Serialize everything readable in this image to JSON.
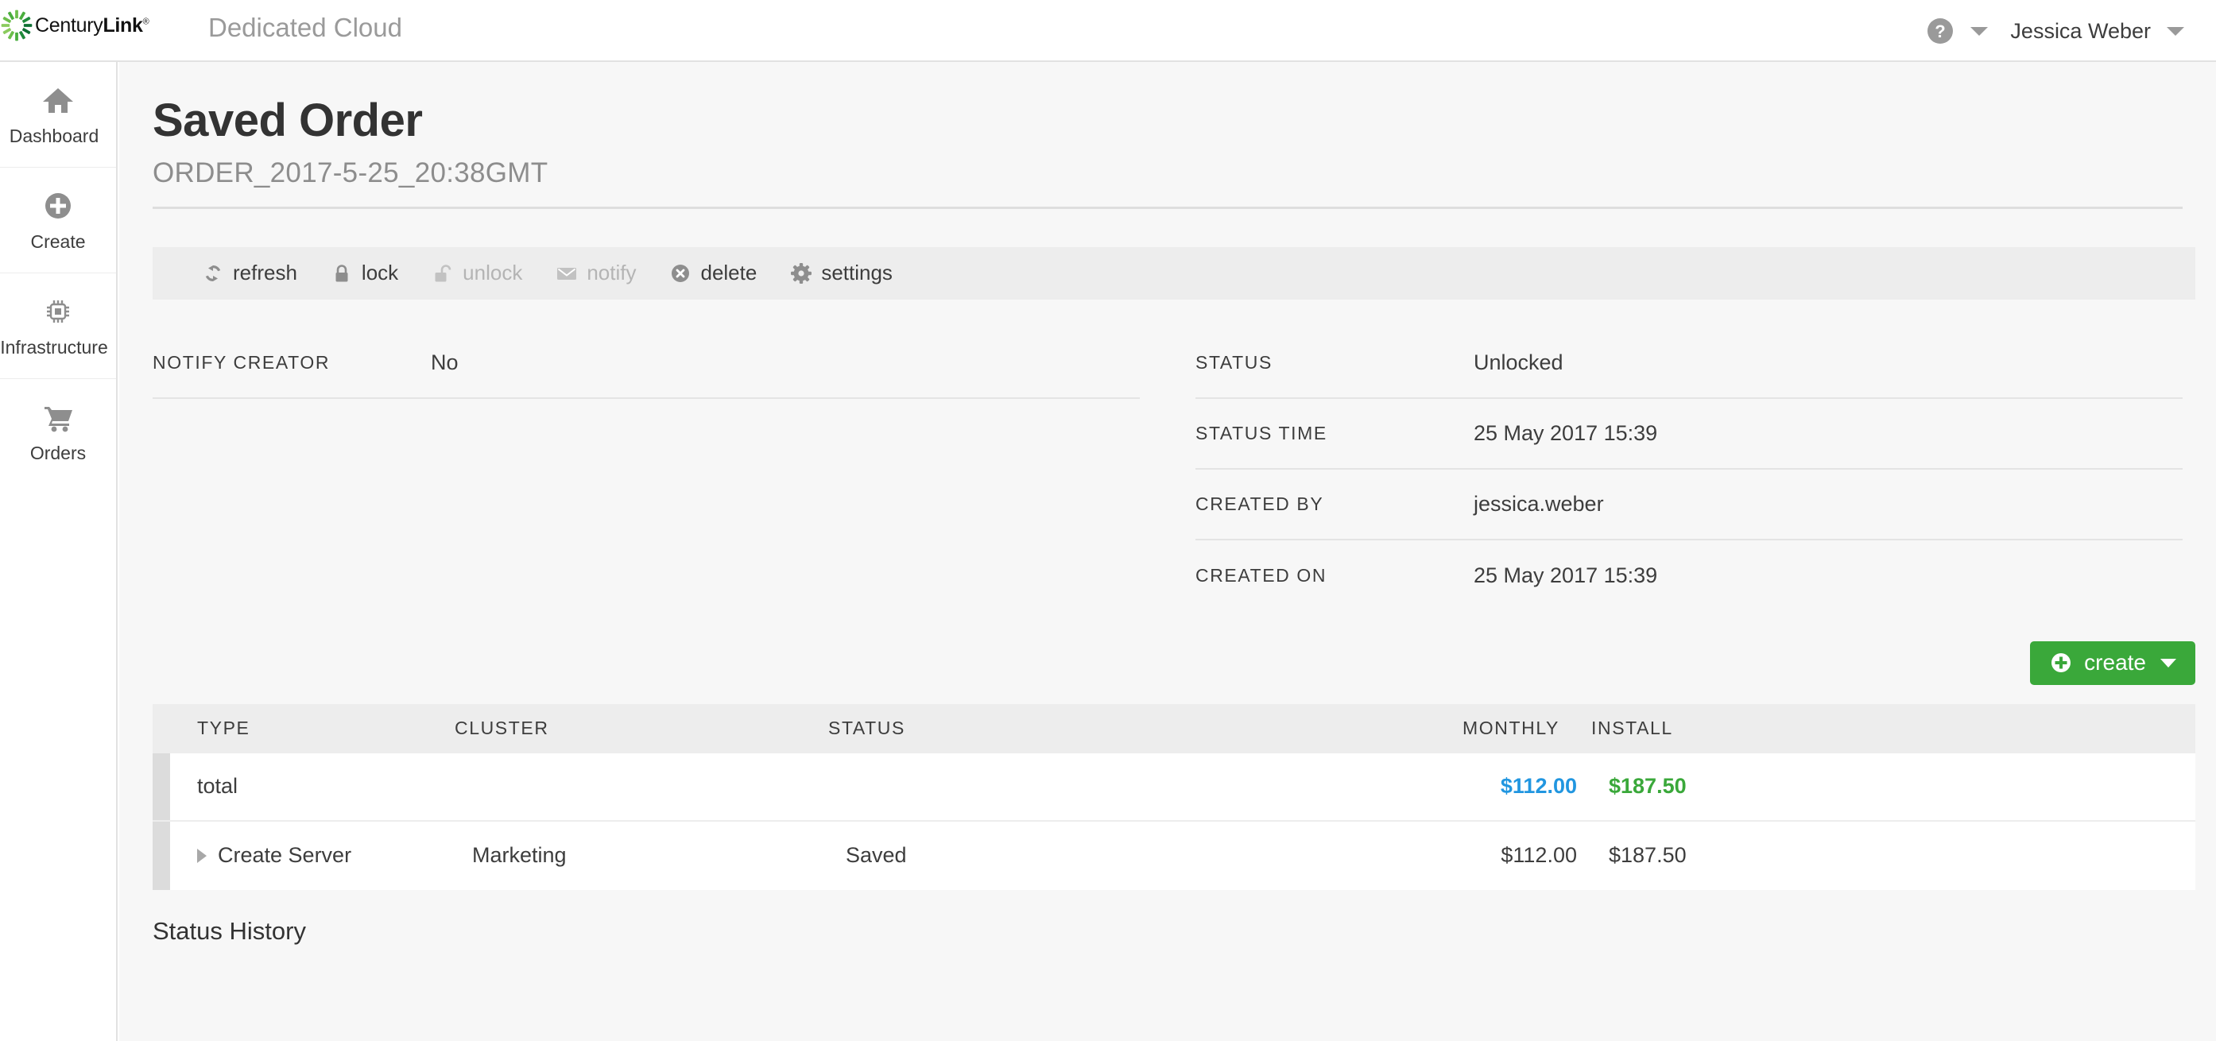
{
  "topbar": {
    "brand_name": "CenturyLink",
    "brand_registered": "®",
    "app_title": "Dedicated Cloud",
    "help_icon": "help-circle-icon",
    "help_caret_icon": "chevron-down-icon",
    "user_name": "Jessica Weber",
    "user_caret_icon": "chevron-down-icon"
  },
  "sidebar": {
    "items": [
      {
        "label": "Dashboard",
        "icon": "home-icon"
      },
      {
        "label": "Create",
        "icon": "plus-circle-icon"
      },
      {
        "label": "Infrastructure",
        "icon": "cpu-chip-icon"
      },
      {
        "label": "Orders",
        "icon": "shopping-cart-icon"
      }
    ]
  },
  "page": {
    "title": "Saved Order",
    "subtitle": "ORDER_2017-5-25_20:38GMT"
  },
  "toolbar": {
    "actions": [
      {
        "label": "refresh",
        "icon": "refresh-icon",
        "disabled": false
      },
      {
        "label": "lock",
        "icon": "lock-icon",
        "disabled": false
      },
      {
        "label": "unlock",
        "icon": "unlock-icon",
        "disabled": true
      },
      {
        "label": "notify",
        "icon": "envelope-icon",
        "disabled": true
      },
      {
        "label": "delete",
        "icon": "delete-icon",
        "disabled": false
      },
      {
        "label": "settings",
        "icon": "gear-icon",
        "disabled": false
      }
    ]
  },
  "details": {
    "left": [
      {
        "label": "NOTIFY CREATOR",
        "value": "No"
      }
    ],
    "right": [
      {
        "label": "STATUS",
        "value": "Unlocked"
      },
      {
        "label": "STATUS TIME",
        "value": "25 May 2017 15:39"
      },
      {
        "label": "CREATED BY",
        "value": "jessica.weber"
      },
      {
        "label": "CREATED ON",
        "value": "25 May 2017 15:39"
      }
    ]
  },
  "create_button": {
    "label": "create",
    "plus_icon": "plus-circle-icon",
    "caret_icon": "chevron-down-icon",
    "color": "#3aa83a"
  },
  "order_table": {
    "columns": [
      "TYPE",
      "CLUSTER",
      "STATUS",
      "MONTHLY",
      "INSTALL"
    ],
    "total_row": {
      "type": "total",
      "cluster": "",
      "status": "",
      "monthly": "$112.00",
      "install": "$187.50",
      "monthly_color": "#2196e0",
      "install_color": "#3aa83a"
    },
    "rows": [
      {
        "expand_icon": "chevron-right-icon",
        "type": "Create Server",
        "cluster": "Marketing",
        "status": "Saved",
        "monthly": "$112.00",
        "install": "$187.50"
      }
    ]
  },
  "status_history": {
    "heading": "Status History"
  }
}
